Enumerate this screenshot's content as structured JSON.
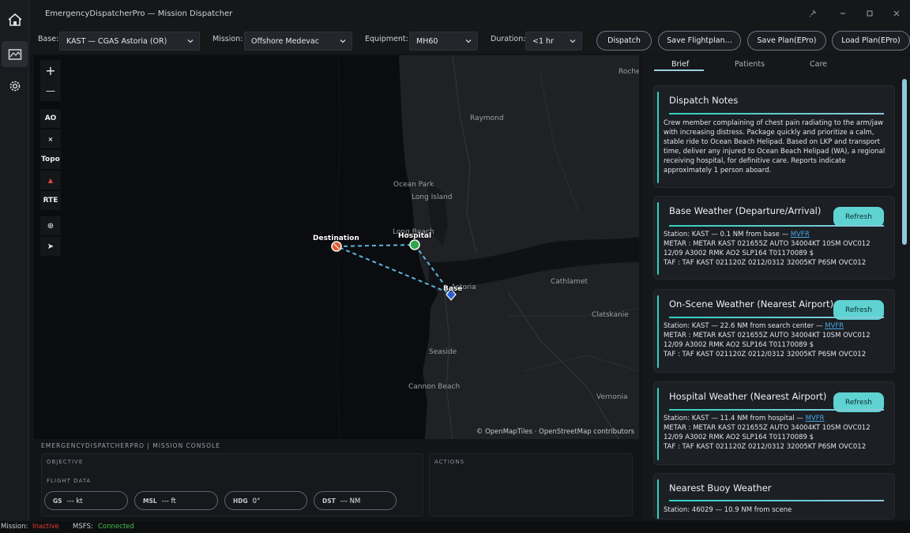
{
  "window": {
    "title": "EmergencyDispatcherPro — Mission Dispatcher"
  },
  "rail": {
    "icons": [
      "home-icon",
      "map-icon",
      "gear-icon"
    ]
  },
  "toolbar": {
    "base_label": "Base:",
    "base_value": "KAST — CGAS Astoria (OR)",
    "mission_label": "Mission:",
    "mission_value": "Offshore Medevac",
    "equipment_label": "Equipment:",
    "equipment_value": "MH60",
    "duration_label": "Duration:",
    "duration_value": "<1 hr",
    "dispatch": "Dispatch",
    "save_flightplan": "Save Flightplan...",
    "save_plan": "Save Plan(EPro)",
    "load_plan": "Load Plan(EPro)"
  },
  "map": {
    "controls": [
      "+",
      "—",
      "AO",
      "×",
      "Topo",
      "▲",
      "RTE",
      "⊕",
      "➤"
    ],
    "places": [
      "Roche",
      "Raymond",
      "Ocean Park",
      "Long Island",
      "Long Beach",
      "Astoria",
      "Cathlamet",
      "Clatskanie",
      "Seaside",
      "Cannon Beach",
      "Vernonia"
    ],
    "markers": {
      "destination": "Destination",
      "hospital": "Hospital",
      "base": "Base"
    },
    "attribution": "© OpenMapTiles · OpenStreetMap contributors"
  },
  "console": {
    "title": "EMERGENCYDISPATCHERPRO | MISSION CONSOLE",
    "objective": "OBJECTIVE",
    "flight_data": "FLIGHT DATA",
    "actions": "ACTIONS",
    "gs_label": "GS",
    "gs_value": "--- kt",
    "msl_label": "MSL",
    "msl_value": "--- ft",
    "hdg_label": "HDG",
    "hdg_value": "0°",
    "dst_label": "DST",
    "dst_value": "--- NM"
  },
  "panel": {
    "tabs": [
      "Brief",
      "Patients",
      "Care"
    ],
    "notes": {
      "title": "Dispatch Notes",
      "text": "Crew member complaining of chest pain radiating to the arm/jaw with increasing distress. Package quickly and prioritize a calm, stable ride to Ocean Beach Helipad. Based on LKP and transport time, deliver any injured to Ocean Beach Helipad (WA), a regional receiving hospital, for definitive care. Reports indicate approximately 1 person aboard."
    },
    "refresh": "Refresh",
    "base_wx": {
      "title": "Base Weather (Departure/Arrival)",
      "station": "Station: KAST — 0.1 NM from base — ",
      "cat": "MVFR",
      "metar": "METAR : METAR KAST 021655Z AUTO 34004KT 10SM OVC012 12/09 A3002 RMK AO2 SLP164 T01170089 $",
      "taf": "TAF   : TAF KAST 021120Z 0212/0312 32005KT P6SM OVC012"
    },
    "scene_wx": {
      "title": "On-Scene Weather (Nearest Airport)",
      "station": "Station: KAST — 22.6 NM from search center — ",
      "cat": "MVFR",
      "metar": "METAR : METAR KAST 021655Z AUTO 34004KT 10SM OVC012 12/09 A3002 RMK AO2 SLP164 T01170089 $",
      "taf": "TAF   : TAF KAST 021120Z 0212/0312 32005KT P6SM OVC012"
    },
    "hosp_wx": {
      "title": "Hospital Weather (Nearest Airport)",
      "station": "Station: KAST — 11.4 NM from hospital — ",
      "cat": "MVFR",
      "metar": "METAR : METAR KAST 021655Z AUTO 34004KT 10SM OVC012 12/09 A3002 RMK AO2 SLP164 T01170089 $",
      "taf": "TAF   : TAF KAST 021120Z 0212/0312 32005KT P6SM OVC012"
    },
    "buoy_wx": {
      "title": "Nearest Buoy Weather",
      "station": "Station: 46029 — 10.9 NM from scene"
    }
  },
  "status": {
    "mission_label": "Mission:",
    "mission_value": "Inactive",
    "msfs_label": "MSFS:",
    "msfs_value": "Connected",
    "colors": {
      "inactive": "#e53935",
      "connected": "#43c24a",
      "accent": "#2fd1c0"
    }
  }
}
